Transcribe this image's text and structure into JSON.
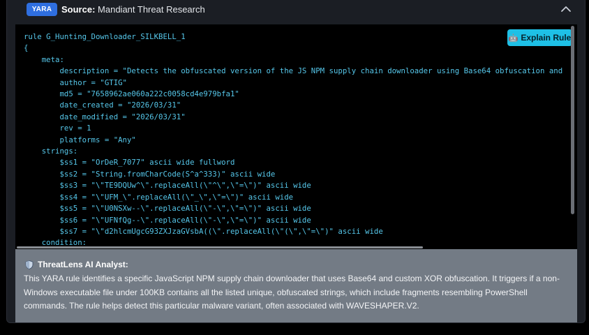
{
  "source": {
    "badge": "YARA",
    "label": "Source:",
    "value": "Mandiant Threat Research"
  },
  "code": {
    "explain_button": "Explain Rule",
    "lines": [
      "rule G_Hunting_Downloader_SILKBELL_1",
      "{",
      "    meta:",
      "        description = \"Detects the obfuscated version of the JS NPM supply chain downloader using Base64 obfuscation and",
      "        author = \"GTIG\"",
      "        md5 = \"7658962ae060a222c0058cd4e979bfa1\"",
      "        date_created = \"2026/03/31\"",
      "        date_modified = \"2026/03/31\"",
      "        rev = 1",
      "        platforms = \"Any\"",
      "    strings:",
      "        $ss1 = \"OrDeR_7077\" ascii wide fullword",
      "        $ss2 = \"String.fromCharCode(S^a^333)\" ascii wide",
      "        $ss3 = \"\\\"TE9DQUw^\\\".replaceAll(\\\"^\\\",\\\"=\\\")\" ascii wide",
      "        $ss4 = \"\\\"UFM_\\\".replaceAll(\\\"_\\\",\\\"=\\\")\" ascii wide",
      "        $ss5 = \"\\\"U0NSXw--\\\".replaceAll(\\\"-\\\",\\\"=\\\")\" ascii wide",
      "        $ss6 = \"\\\"UFNfQg--\\\".replaceAll(\\\"-\\\",\\\"=\\\")\" ascii wide",
      "        $ss7 = \"\\\"d2hlcmUgcG93ZXJzaGVsbA((\\\".replaceAll(\\\"(\\\",\\\"=\\\")\" ascii wide",
      "    condition:"
    ]
  },
  "analyst": {
    "title": "ThreatLens AI Analyst:",
    "text": "This YARA rule identifies a specific JavaScript NPM supply chain downloader that uses Base64 and custom XOR obfuscation. It triggers if a non-Windows executable file under 100KB contains all the listed unique, obfuscated strings, which include fragments resembling PowerShell commands. The rule helps detect this particular malware variant, often associated with WAVESHAPER.V2."
  },
  "colors": {
    "accent": "#1ec0e6",
    "badge": "#2f6fe0",
    "code_text": "#56c7ea",
    "panel": "#1b1e24",
    "analyst_bg": "#737b85"
  },
  "icons": {
    "collapse": "chevron-up-icon",
    "explain": "robot-icon",
    "analyst": "shield-icon"
  }
}
